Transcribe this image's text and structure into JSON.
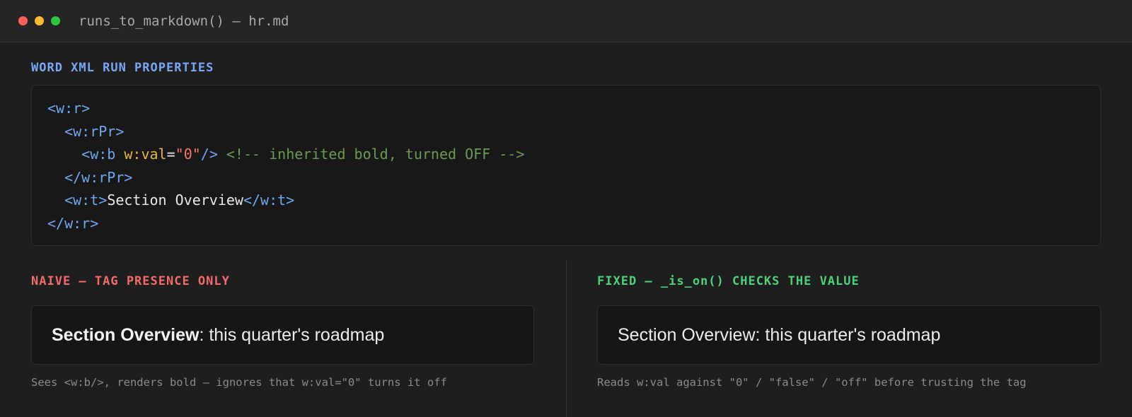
{
  "window": {
    "title": "runs_to_markdown() — hr.md"
  },
  "xml_section": {
    "heading": "WORD XML RUN PROPERTIES",
    "lines": [
      {
        "indent": "",
        "parts": [
          {
            "t": "tag",
            "v": "<w:r>"
          }
        ]
      },
      {
        "indent": "  ",
        "parts": [
          {
            "t": "tag",
            "v": "<w:rPr>"
          }
        ]
      },
      {
        "indent": "    ",
        "parts": [
          {
            "t": "tag",
            "v": "<w:b "
          },
          {
            "t": "attr",
            "v": "w:val"
          },
          {
            "t": "txt",
            "v": "="
          },
          {
            "t": "str",
            "v": "\"0\""
          },
          {
            "t": "tag",
            "v": "/>"
          },
          {
            "t": "txt",
            "v": " "
          },
          {
            "t": "cmt",
            "v": "<!-- inherited bold, turned OFF -->"
          }
        ]
      },
      {
        "indent": "  ",
        "parts": [
          {
            "t": "tag",
            "v": "</w:rPr>"
          }
        ]
      },
      {
        "indent": "  ",
        "parts": [
          {
            "t": "tag",
            "v": "<w:t>"
          },
          {
            "t": "txt",
            "v": "Section Overview"
          },
          {
            "t": "tag",
            "v": "</w:t>"
          }
        ]
      },
      {
        "indent": "",
        "parts": [
          {
            "t": "tag",
            "v": "</w:r>"
          }
        ]
      }
    ]
  },
  "naive": {
    "heading": "NAIVE — TAG PRESENCE ONLY",
    "bold_text": "Section Overview",
    "rest_text": ": this quarter's roadmap",
    "caption": "Sees <w:b/>, renders bold — ignores that w:val=\"0\" turns it off"
  },
  "fixed": {
    "heading": "FIXED — _is_on() CHECKS THE VALUE",
    "text": "Section Overview: this quarter's roadmap",
    "caption": "Reads w:val against \"0\" / \"false\" / \"off\" before trusting the tag"
  },
  "colors": {
    "tag": "#6fa6f0",
    "attr": "#e5b645",
    "string": "#f07a6b",
    "comment": "#6a9955",
    "heading_blue": "#7aa7f5",
    "heading_red": "#f26b6b",
    "heading_green": "#4cd17a"
  }
}
